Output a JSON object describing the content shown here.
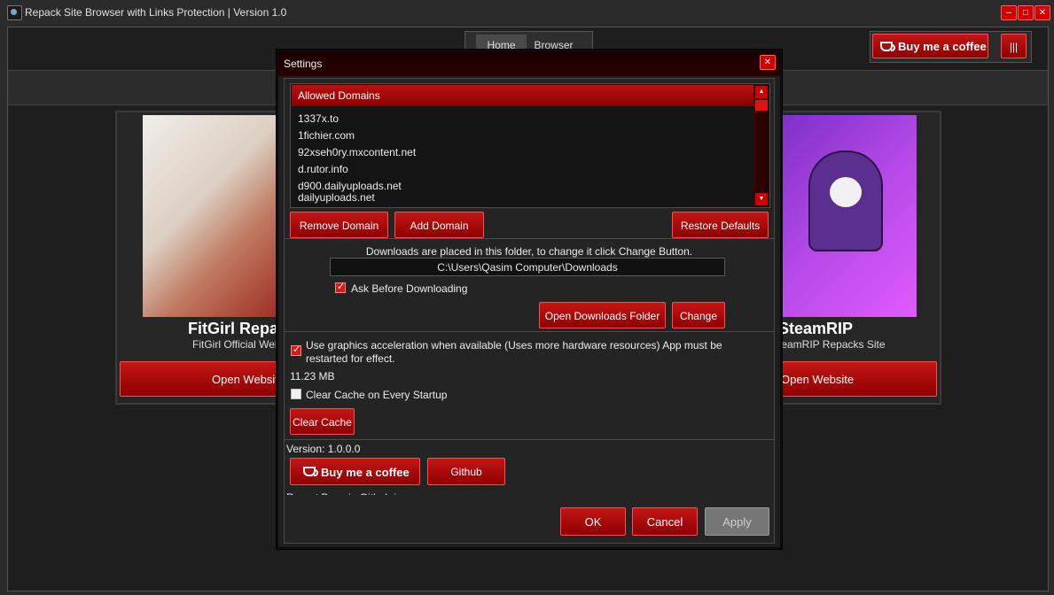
{
  "app": {
    "title": "Repack Site Browser with Links Protection | Version 1.0",
    "window_buttons": {
      "minimize": "–",
      "maximize": "□",
      "close": "✕"
    }
  },
  "top_tabs": [
    {
      "label": "Home"
    },
    {
      "label": "Browser"
    }
  ],
  "top_actions": {
    "coffee_label": "Buy me a coffee",
    "menu_label": "|||"
  },
  "cards": [
    {
      "title": "FitGirl Repacks",
      "subtitle": "FitGirl Official Website",
      "button": "Open Website"
    },
    {
      "title": "SteamRIP",
      "subtitle": "SteamRIP Repacks Site",
      "button": "Open Website"
    }
  ],
  "dialog": {
    "title": "Settings",
    "close_label": "✕",
    "domains": {
      "header": "Allowed Domains",
      "items": [
        "1337x.to",
        "1fichier.com",
        "92xseh0ry.mxcontent.net",
        "d.rutor.info",
        "d900.dailyuploads.net",
        "dailyuploads.net"
      ]
    },
    "domain_buttons": {
      "remove": "Remove Domain",
      "add": "Add Domain",
      "restore": "Restore Defaults"
    },
    "downloads": {
      "hint": "Downloads are placed in this folder, to change it click Change Button.",
      "path": "C:\\Users\\Qasim Computer\\Downloads",
      "ask_label": "Ask Before Downloading",
      "open_folder": "Open Downloads Folder",
      "change": "Change"
    },
    "graphics": {
      "accel_label": "Use graphics acceleration when available (Uses more hardware resources) App must be restarted for effect.",
      "cache_size": "11.23 MB",
      "clear_on_startup_label": "Clear Cache on Every Startup",
      "clear_cache": "Clear Cache"
    },
    "about": {
      "version": "Version: 1.0.0.0",
      "coffee": "Buy me a coffee",
      "github": "Github",
      "report": "Report Bugs in Github issues page."
    },
    "footer": {
      "ok": "OK",
      "cancel": "Cancel",
      "apply": "Apply"
    }
  },
  "colors": {
    "accent": "#c00000",
    "background": "#1e1e1e",
    "disabled": "#767676"
  }
}
